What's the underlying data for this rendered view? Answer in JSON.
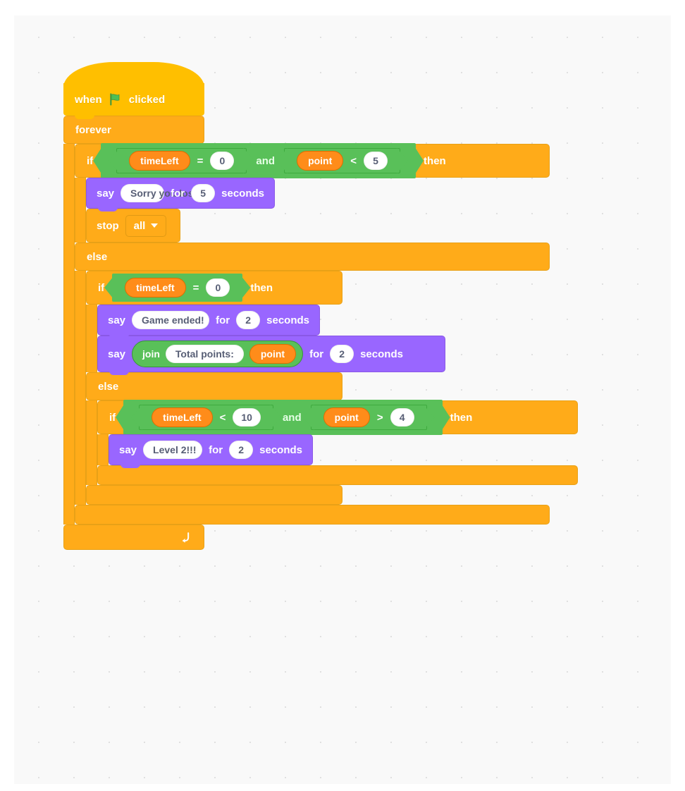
{
  "editor": {
    "name": "scratch-block-canvas",
    "background_color": "#f9f9f9",
    "grid_dot_color": "#e0e0e0"
  },
  "palette": {
    "events_color": "#ffbf00",
    "control_color": "#ffab19",
    "looks_color": "#9966ff",
    "operators_color": "#59c059",
    "variables_color": "#ff8c1a",
    "input_text_color": "#575e75"
  },
  "script": {
    "hat": {
      "word_when": "when",
      "flag_icon": "green-flag-icon",
      "word_clicked": "clicked"
    },
    "forever": {
      "label": "forever",
      "loop_icon": "loop-arrow-icon"
    },
    "if1": {
      "keyword_if": "if",
      "keyword_then": "then",
      "keyword_else": "else",
      "condition": {
        "operator": "and",
        "left": {
          "variable": "timeLeft",
          "operator": "=",
          "value": "0"
        },
        "right": {
          "variable": "point",
          "operator": "<",
          "value": "5"
        }
      },
      "body": [
        {
          "type": "say-for-seconds",
          "keyword_say": "say",
          "message": "Sorry you lost!",
          "keyword_for": "for",
          "seconds": "5",
          "keyword_seconds": "seconds"
        },
        {
          "type": "stop",
          "keyword_stop": "stop",
          "option": "all"
        }
      ]
    },
    "if2": {
      "keyword_if": "if",
      "keyword_then": "then",
      "keyword_else": "else",
      "condition": {
        "variable": "timeLeft",
        "operator": "=",
        "value": "0"
      },
      "body": [
        {
          "type": "say-for-seconds",
          "keyword_say": "say",
          "message": "Game ended!",
          "keyword_for": "for",
          "seconds": "2",
          "keyword_seconds": "seconds"
        },
        {
          "type": "say-join-for-seconds",
          "keyword_say": "say",
          "keyword_join": "join",
          "join_text": "Total points:",
          "join_variable": "point",
          "keyword_for": "for",
          "seconds": "2",
          "keyword_seconds": "seconds"
        }
      ]
    },
    "if3": {
      "keyword_if": "if",
      "keyword_then": "then",
      "condition": {
        "operator": "and",
        "left": {
          "variable": "timeLeft",
          "operator": "<",
          "value": "10"
        },
        "right": {
          "variable": "point",
          "operator": ">",
          "value": "4"
        }
      },
      "body": [
        {
          "type": "say-for-seconds",
          "keyword_say": "say",
          "message": "Level 2!!!",
          "keyword_for": "for",
          "seconds": "2",
          "keyword_seconds": "seconds"
        }
      ]
    }
  }
}
